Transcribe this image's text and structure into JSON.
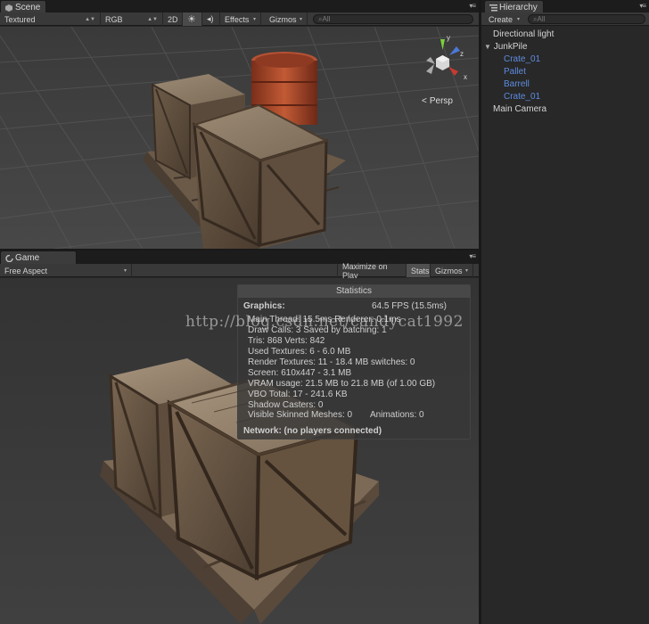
{
  "scene": {
    "tab_label": "Scene",
    "toolbar": {
      "shading_mode": "Textured",
      "render_mode": "RGB",
      "two_d": "2D",
      "effects": "Effects",
      "gizmos": "Gizmos",
      "search_placeholder": "All"
    },
    "persp_label": "Persp",
    "axis_labels": {
      "y": "y",
      "z": "z",
      "x": "x"
    }
  },
  "hierarchy": {
    "tab_label": "Hierarchy",
    "create_label": "Create",
    "search_placeholder": "All",
    "items": [
      {
        "label": "Directional light"
      },
      {
        "label": "JunkPile"
      },
      {
        "label": "Crate_01"
      },
      {
        "label": "Pallet"
      },
      {
        "label": "Barrell"
      },
      {
        "label": "Crate_01"
      },
      {
        "label": "Main Camera"
      }
    ]
  },
  "game": {
    "tab_label": "Game",
    "aspect": "Free Aspect",
    "maximize_on_play": "Maximize on Play",
    "stats_button": "Stats",
    "gizmos": "Gizmos"
  },
  "statistics": {
    "title": "Statistics",
    "graphics_label": "Graphics:",
    "fps": "64.5 FPS (15.5ms)",
    "main_thread": "Main Thread: 15.5ms  Renderer: 0.1ms",
    "draw_calls": "Draw Calls: 3  Saved by batching: 1",
    "tris": "Tris: 868   Verts: 842",
    "used_textures": "Used Textures: 6 - 6.0 MB",
    "render_textures": "Render Textures: 11 - 18.4 MB  switches: 0",
    "screen": "Screen: 610x447 - 3.1 MB",
    "vram": "VRAM usage: 21.5 MB to 21.8 MB (of 1.00 GB)",
    "vbo": "VBO Total: 17 - 241.6 KB",
    "shadow_casters": "Shadow Casters: 0",
    "skinned_meshes": "Visible Skinned Meshes: 0",
    "animations": "Animations: 0",
    "network": "Network: (no players connected)"
  },
  "watermark": "http://blog.csdn.net/candycat1992",
  "colors": {
    "prefab_blue": "#5d8ce0",
    "panel_bg": "#282828",
    "toolbar_bg": "#393939",
    "gizmo_y": "#7cd13a",
    "gizmo_z": "#4a79d6",
    "gizmo_x": "#c83a30"
  }
}
